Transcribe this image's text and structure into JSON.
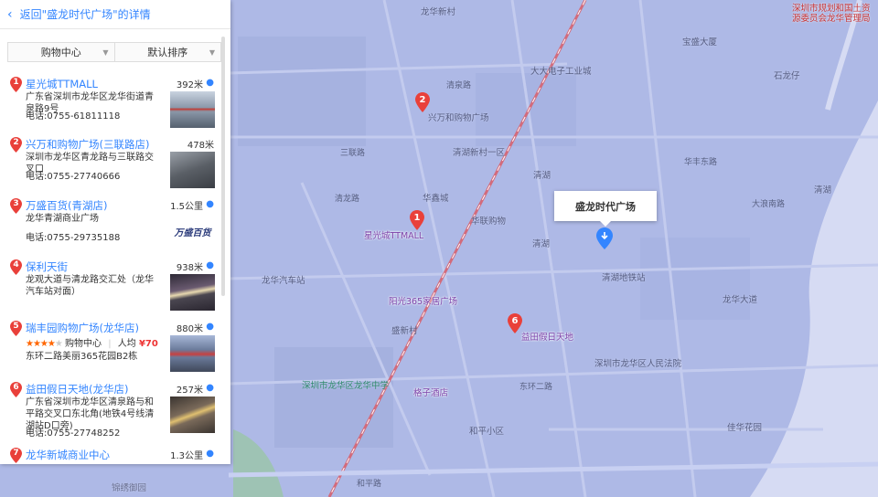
{
  "panel": {
    "back_text": "返回\"盛龙时代广场\"的详情",
    "filter_category": "购物中心",
    "filter_sort": "默认排序"
  },
  "results": [
    {
      "index": "1",
      "name": "星光城TTMALL",
      "distance": "392米",
      "address": "广东省深圳市龙华区龙华街道青泉路9号",
      "phone": "电话:0755-61811118",
      "thumb_color": "#8a97a8"
    },
    {
      "index": "2",
      "name": "兴万和购物广场(三联路店)",
      "distance": "478米",
      "address": "深圳市龙华区青龙路与三联路交叉口",
      "phone": "电话:0755-27740666",
      "thumb_color": "#5a5f66"
    },
    {
      "index": "3",
      "name": "万盛百货(青湖店)",
      "distance": "1.5公里",
      "address": "龙华青湖商业广场",
      "phone": "电话:0755-29735188",
      "logo_text": "万盛百货"
    },
    {
      "index": "4",
      "name": "保利天街",
      "distance": "938米",
      "address": "龙观大道与清龙路交汇处（龙华汽车站对面）",
      "thumb_color": "#4a4650"
    },
    {
      "index": "5",
      "name": "瑞丰园购物广场(龙华店)",
      "distance": "880米",
      "rating_stars": 4,
      "category": "购物中心",
      "price_label": "人均",
      "price": "¥70",
      "address": "东环二路美丽365花园B2栋",
      "thumb_color": "#6a7a9a"
    },
    {
      "index": "6",
      "name": "益田假日天地(龙华店)",
      "distance": "257米",
      "address": "广东省深圳市龙华区清泉路与和平路交叉口东北角(地铁4号线清湖站D口旁)",
      "phone": "电话:0755-27748252",
      "thumb_color": "#7a6a5a"
    },
    {
      "index": "7",
      "name": "龙华新城商业中心",
      "distance": "1.3公里"
    }
  ],
  "map": {
    "center_popup": "盛龙时代广场",
    "accent_blue": "#3385ff",
    "marker_red": "#e9403a",
    "poi_markers": [
      {
        "index": "1",
        "label": "星光城TTMALL"
      },
      {
        "index": "2",
        "label": "兴万和购物广场"
      },
      {
        "index": "6",
        "label": "益田假日天地"
      }
    ],
    "labels": {
      "l1": "深圳市规划和国土资源委员会龙华管理局",
      "l2": "龙华新村",
      "l3": "清泉路",
      "l4": "大大电子工业城",
      "l5": "清湖",
      "l6": "清湖",
      "l7": "华联购物",
      "l8": "华鑫城",
      "l9": "兴万和购物广场",
      "l10": "阳光365家居广场",
      "l11": "深圳市龙华区龙华中学",
      "l12": "格子酒店",
      "l13": "和平小区",
      "l14": "三联路",
      "l15": "清龙路",
      "l16": "龙华汽车站",
      "l17": "锦绣御园",
      "l18": "和平路",
      "l19": "盛新村",
      "l20": "清湖",
      "l21": "深圳市龙华区人民法院",
      "l22": "清湖地铁站",
      "l23": "华丰东路",
      "l24": "东环二路",
      "l25": "龙华大道",
      "l26": "佳华花园",
      "l27": "宝盛大厦",
      "l28": "清湖新村一区",
      "l29": "石龙仔",
      "l30": "大浪南路"
    }
  }
}
